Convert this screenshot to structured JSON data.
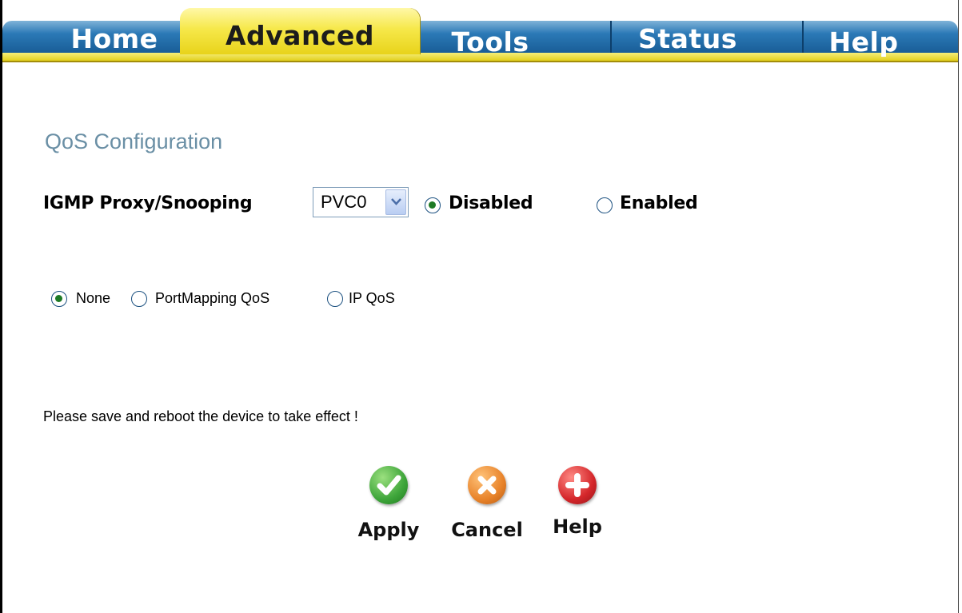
{
  "tabs": [
    {
      "label": "Home",
      "active": false
    },
    {
      "label": "Advanced",
      "active": true
    },
    {
      "label": "Tools",
      "active": false
    },
    {
      "label": "Status",
      "active": false
    },
    {
      "label": "Help",
      "active": false
    }
  ],
  "page": {
    "title": "QoS Configuration"
  },
  "igmp": {
    "label": "IGMP Proxy/Snooping",
    "pvc_selected": "PVC0",
    "disabled_label": "Disabled",
    "enabled_label": "Enabled",
    "selected": "Disabled"
  },
  "qos_mode": {
    "options": [
      "None",
      "PortMapping QoS",
      "IP QoS"
    ],
    "selected": "None"
  },
  "notice": "Please save and reboot the device to take effect !",
  "actions": {
    "apply_label": "Apply",
    "cancel_label": "Cancel",
    "help_label": "Help"
  },
  "colors": {
    "tab_blue": "#2b79b6",
    "tab_yellow": "#f6e84a",
    "title": "#6a8fa5",
    "apply_green": "#3ea53a",
    "cancel_orange": "#e8832a",
    "help_red": "#d4262a"
  },
  "icons": {
    "apply": "check-icon",
    "cancel": "x-icon",
    "help": "plus-icon"
  }
}
